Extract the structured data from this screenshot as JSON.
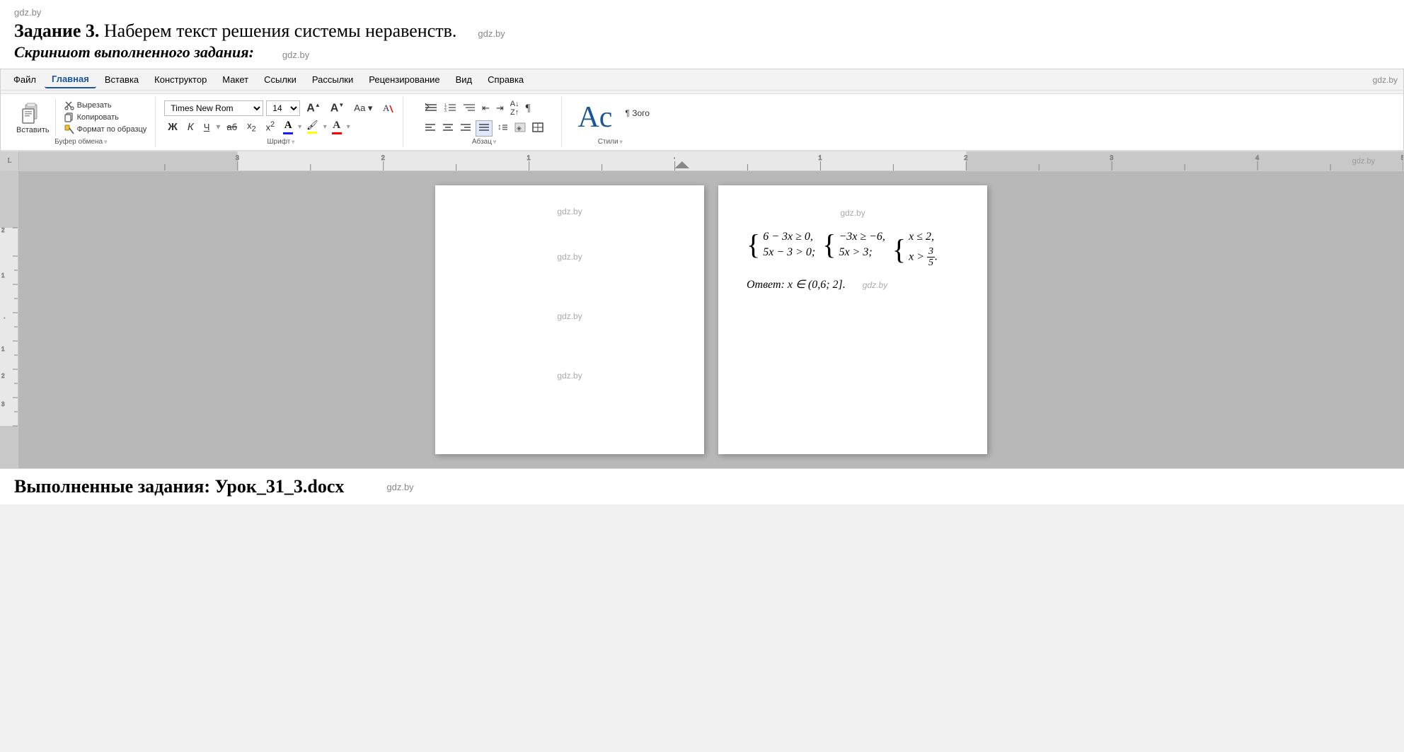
{
  "watermarks": {
    "top_left": "gdz.by",
    "top_right_1": "gdz.by",
    "top_right_2": "gdz.by",
    "ribbon_center": "gdz.by",
    "ribbon_right": "gdz.by",
    "ruler": "gdz.by",
    "page1_top": "gdz.by",
    "page1_mid": "gdz.by",
    "page1_bot": "gdz.by",
    "page1_bot2": "gdz.by",
    "page2_top": "gdz.by",
    "page2_math": "gdz.by",
    "bottom": "gdz.by"
  },
  "header": {
    "zadanie": "Задание 3.",
    "zadanie_rest": " Наберем текст решения системы неравенств.",
    "screenshot_label": "Скриншот выполненного задания:"
  },
  "menu": {
    "items": [
      {
        "label": "Файл",
        "active": false
      },
      {
        "label": "Главная",
        "active": true
      },
      {
        "label": "Вставка",
        "active": false
      },
      {
        "label": "Конструктор",
        "active": false
      },
      {
        "label": "Макет",
        "active": false
      },
      {
        "label": "Ссылки",
        "active": false
      },
      {
        "label": "Рассылки",
        "active": false
      },
      {
        "label": "Рецензирование",
        "active": false
      },
      {
        "label": "Вид",
        "active": false
      },
      {
        "label": "Справка",
        "active": false
      }
    ]
  },
  "ribbon": {
    "clipboard": {
      "label": "Буфер обмена",
      "paste": "Вставить",
      "cut": "Вырезать",
      "copy": "Копировать",
      "format_painter": "Формат по образцу"
    },
    "font": {
      "label": "Шрифт",
      "font_name": "Times New Rom",
      "font_size": "14",
      "grow": "A",
      "shrink": "A",
      "change_case": "Аа",
      "clear_format": "А",
      "bold": "Ж",
      "italic": "К",
      "underline": "Ч",
      "strikethrough": "аб",
      "subscript": "x₂",
      "superscript": "x²",
      "font_color": "А",
      "highlight": ""
    },
    "paragraph": {
      "label": "Абзац"
    },
    "styles": {
      "label": "Стили",
      "sample": "Ac",
      "sample2": "¶ Зого"
    }
  },
  "ruler": {
    "marker": "L"
  },
  "page_left": {
    "watermarks": [
      "gdz.by",
      "gdz.by",
      "gdz.by",
      "gdz.by"
    ]
  },
  "page_right": {
    "watermark_top": "gdz.by",
    "watermark_math": "gdz.by",
    "system1_line1": "6 − 3x ≥ 0,",
    "system1_line2": "5x − 3 > 0;",
    "system2_line1": "−3x ≥ −6,",
    "system2_line2": "5x > 3;",
    "system3_line1": "x ≤ 2,",
    "system3_line2": "x > 3/5.",
    "answer": "Ответ: x ∈ (0,6; 2]."
  },
  "bottom": {
    "label": "Выполненные задания: Урок_31_3.docx",
    "watermark": "gdz.by"
  }
}
